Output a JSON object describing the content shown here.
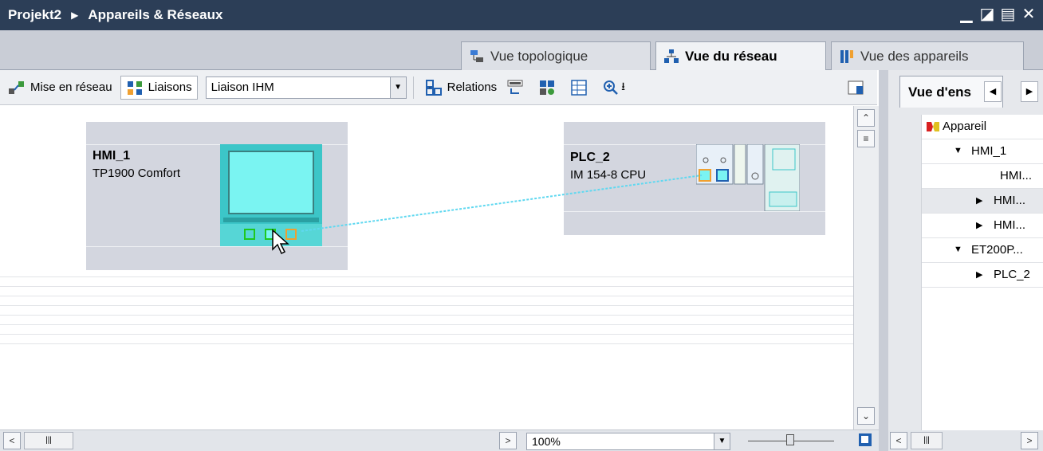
{
  "window": {
    "breadcrumb_project": "Projekt2",
    "breadcrumb_separator": "▶",
    "breadcrumb_page": "Appareils & Réseaux",
    "controls": [
      "minimize-icon",
      "restore-icon",
      "maximize-icon",
      "close-icon"
    ]
  },
  "view_tabs": [
    {
      "label": "Vue topologique",
      "icon": "topology-icon",
      "active": false
    },
    {
      "label": "Vue du réseau",
      "icon": "network-icon",
      "active": true
    },
    {
      "label": "Vue des appareils",
      "icon": "devices-icon",
      "active": false
    }
  ],
  "toolbar": {
    "network_label": "Mise en réseau",
    "connections_label": "Liaisons",
    "connection_type_value": "Liaison IHM",
    "relations_label": "Relations"
  },
  "devices": [
    {
      "name": "HMI_1",
      "type": "TP1900 Comfort"
    },
    {
      "name": "PLC_2",
      "type": "IM 154-8 CPU"
    }
  ],
  "statusbar": {
    "zoom_value": "100%"
  },
  "right_panel": {
    "tab_label": "Vue d'ens",
    "column_header": "Appareil",
    "tree": [
      {
        "label": "HMI_1",
        "expander": "▼",
        "indent": 1
      },
      {
        "label": "HMI...",
        "expander": "",
        "indent": 3
      },
      {
        "label": "HMI...",
        "expander": "▶",
        "indent": 2
      },
      {
        "label": "HMI...",
        "expander": "▶",
        "indent": 2
      },
      {
        "label": "ET200P...",
        "expander": "▼",
        "indent": 1
      },
      {
        "label": "PLC_2",
        "expander": "▶",
        "indent": 2
      }
    ]
  },
  "colors": {
    "title_bar": "#2c3e57",
    "device_box": "#d3d6df",
    "hmi_body": "#3cc6c8",
    "hmi_screen": "#7af4f2",
    "connection_line": "#5fd8f0",
    "port_green": "#1ec81e",
    "port_orange": "#f0a030"
  }
}
